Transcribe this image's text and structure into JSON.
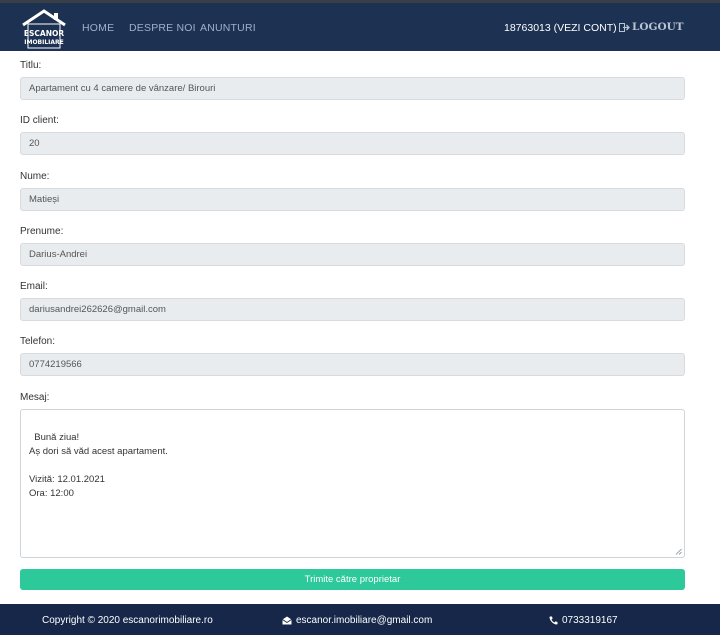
{
  "nav": {
    "logo_line1": "ESCANOR",
    "logo_line2": "IMOBILIARE",
    "home": "HOME",
    "despre": "DESPRE NOI",
    "anunturi": "ANUNTURI",
    "account": "18763013 (VEZI CONT)",
    "logout": "LOGOUT"
  },
  "form": {
    "titlu_label": "Titlu:",
    "titlu_value": "Apartament cu 4 camere de vânzare/ Birouri",
    "id_label": "ID client:",
    "id_value": "20",
    "nume_label": "Nume:",
    "nume_value": "Matieși",
    "prenume_label": "Prenume:",
    "prenume_value": "Darius-Andrei",
    "email_label": "Email:",
    "email_value": "dariusandrei262626@gmail.com",
    "telefon_label": "Telefon:",
    "telefon_value": "0774219566",
    "mesaj_label": "Mesaj:",
    "mesaj_value": "Bună ziua!\nAș dori să văd acest apartament.\n\nVizită: 12.01.2021\nOra: 12:00",
    "submit_label": "Trimite către proprietar"
  },
  "footer": {
    "copyright": "Copyright © 2020 escanorimobiliare.ro",
    "email": "escanor.imobiliare@gmail.com",
    "phone": "0733319167"
  },
  "colors": {
    "navbar": "#1d3152",
    "footer": "#16274a",
    "submit": "#2dc99a",
    "input_bg": "#e9ecef"
  },
  "icons": [
    "house-logo-icon",
    "logout-icon",
    "envelope-icon",
    "phone-icon"
  ]
}
